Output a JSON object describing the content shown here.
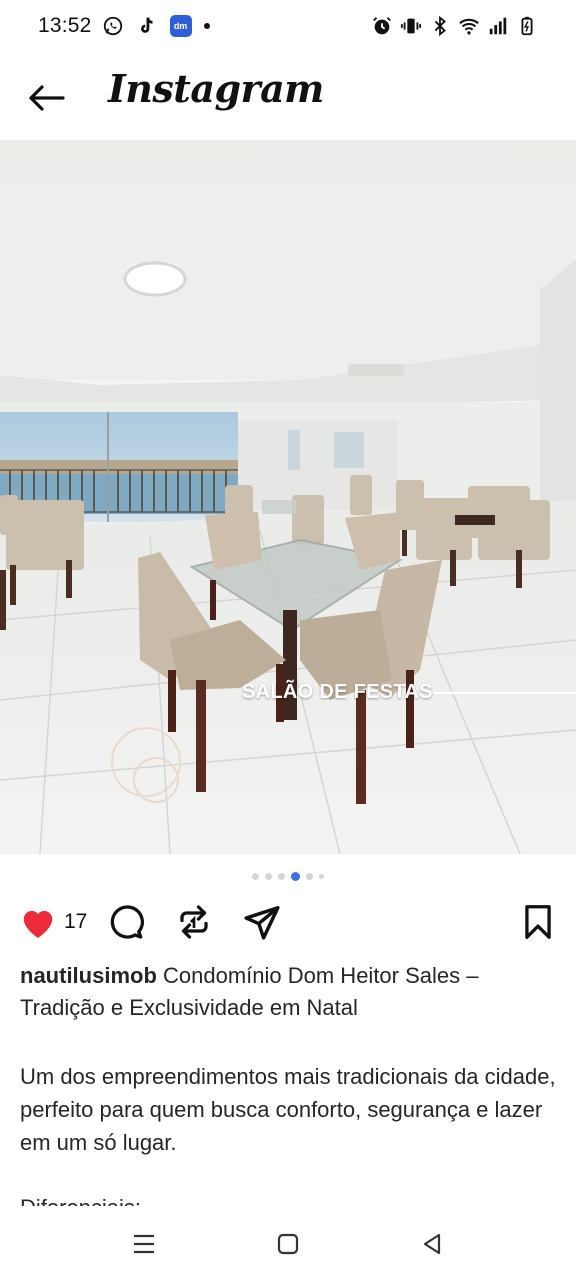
{
  "status_bar": {
    "time": "13:52",
    "left_icons": [
      "whatsapp-icon",
      "tiktok-icon",
      "dm-icon",
      "notification-dot-icon"
    ],
    "dm_label": "dm",
    "right_icons": [
      "alarm-icon",
      "vibrate-icon",
      "bluetooth-icon",
      "wifi-icon",
      "signal-icon",
      "battery-icon"
    ]
  },
  "header": {
    "back_icon": "arrow-left-icon",
    "app_name": "Instagram"
  },
  "post": {
    "image_overlay_label": "SALÃO DE FESTAS",
    "carousel": {
      "total": 6,
      "active_index": 3
    },
    "actions": {
      "like_count": "17",
      "liked": true,
      "like_color": "#ed2a3a",
      "icons": [
        "heart-icon",
        "comment-icon",
        "repost-icon",
        "share-icon",
        "bookmark-icon"
      ]
    },
    "caption": {
      "username": "nautilusimob",
      "title": " Condomínio Dom Heitor Sales – Tradição e Exclusividade em Natal"
    },
    "description": "Um dos empreendimentos mais tradicionais da cidade, perfeito para quem busca conforto, segurança e lazer em um só lugar.",
    "truncated_next_line": "Diferenciais:"
  },
  "nav_bar": {
    "buttons": [
      "menu-icon",
      "home-square-icon",
      "back-triangle-icon"
    ]
  },
  "colors": {
    "accent_dot": "#3f6ee6",
    "like_red": "#ed2a3a",
    "text": "#262626"
  }
}
